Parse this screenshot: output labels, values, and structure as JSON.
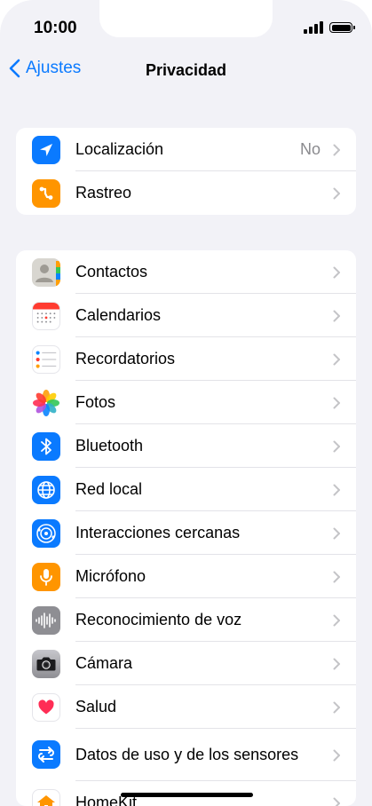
{
  "status": {
    "time": "10:00"
  },
  "nav": {
    "back_label": "Ajustes",
    "title": "Privacidad"
  },
  "group1": [
    {
      "label": "Localización",
      "value": "No",
      "icon": "location-arrow-icon",
      "color": "#0a7aff"
    },
    {
      "label": "Rastreo",
      "icon": "tracking-icon",
      "color": "#ff9500"
    }
  ],
  "group2": [
    {
      "label": "Contactos",
      "icon": "contacts-icon"
    },
    {
      "label": "Calendarios",
      "icon": "calendar-icon"
    },
    {
      "label": "Recordatorios",
      "icon": "reminders-icon"
    },
    {
      "label": "Fotos",
      "icon": "photos-icon"
    },
    {
      "label": "Bluetooth",
      "icon": "bluetooth-icon",
      "color": "#0a7aff"
    },
    {
      "label": "Red local",
      "icon": "globe-icon",
      "color": "#0a7aff"
    },
    {
      "label": "Interacciones cercanas",
      "icon": "nearby-interactions-icon",
      "color": "#0a7aff"
    },
    {
      "label": "Micrófono",
      "icon": "microphone-icon",
      "color": "#ff9500"
    },
    {
      "label": "Reconocimiento de voz",
      "icon": "waveform-icon",
      "color": "#8e8e93"
    },
    {
      "label": "Cámara",
      "icon": "camera-icon",
      "color": "#8e8e93"
    },
    {
      "label": "Salud",
      "icon": "heart-icon",
      "color": "#ff2d55"
    },
    {
      "label": "Datos de uso y de los sensores",
      "icon": "sensor-data-icon",
      "color": "#0a7aff"
    },
    {
      "label": "HomeKit",
      "icon": "home-icon",
      "color": "#ff9500"
    }
  ]
}
